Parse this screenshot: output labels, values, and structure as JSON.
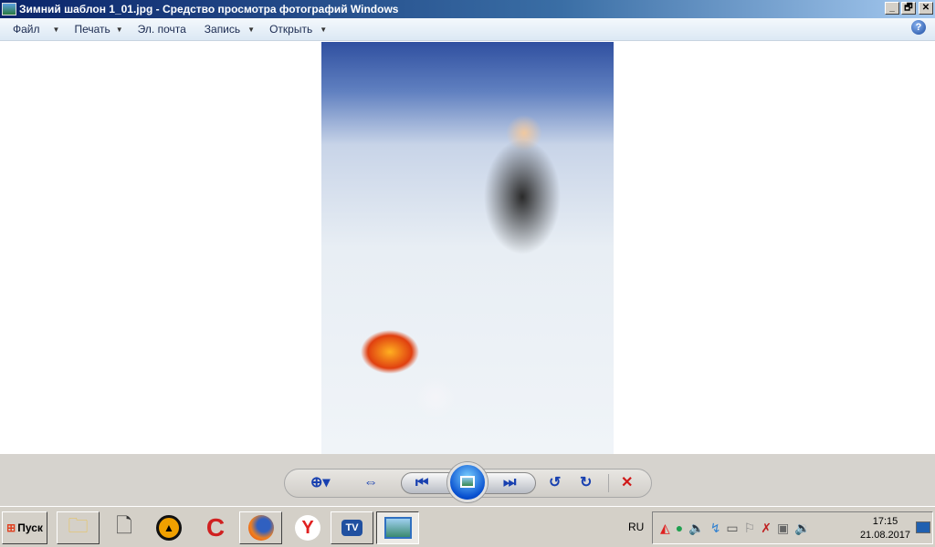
{
  "window": {
    "title": "Зимний шаблон 1_01.jpg - Средство просмотра фотографий Windows",
    "minimize": "_",
    "restore": "🗗",
    "close": "✕"
  },
  "menu": [
    {
      "label": "Файл",
      "dropdown": true
    },
    {
      "label": "Печать",
      "dropdown": true
    },
    {
      "label": "Эл. почта",
      "dropdown": false
    },
    {
      "label": "Запись",
      "dropdown": true
    },
    {
      "label": "Открыть",
      "dropdown": true
    }
  ],
  "help": "?",
  "controls": {
    "zoom": "⊕▾",
    "fit": "⇔",
    "prev": "⏮",
    "next": "⏭",
    "rotate_left": "↺",
    "rotate_right": "↻",
    "delete": "✕"
  },
  "taskbar": {
    "start_label": "Пуск",
    "language": "RU",
    "time": "17:15",
    "date": "21.08.2017"
  },
  "colors": {
    "accent": "#1840b0",
    "delete": "#d01818",
    "title_bar": "#0a246a"
  }
}
